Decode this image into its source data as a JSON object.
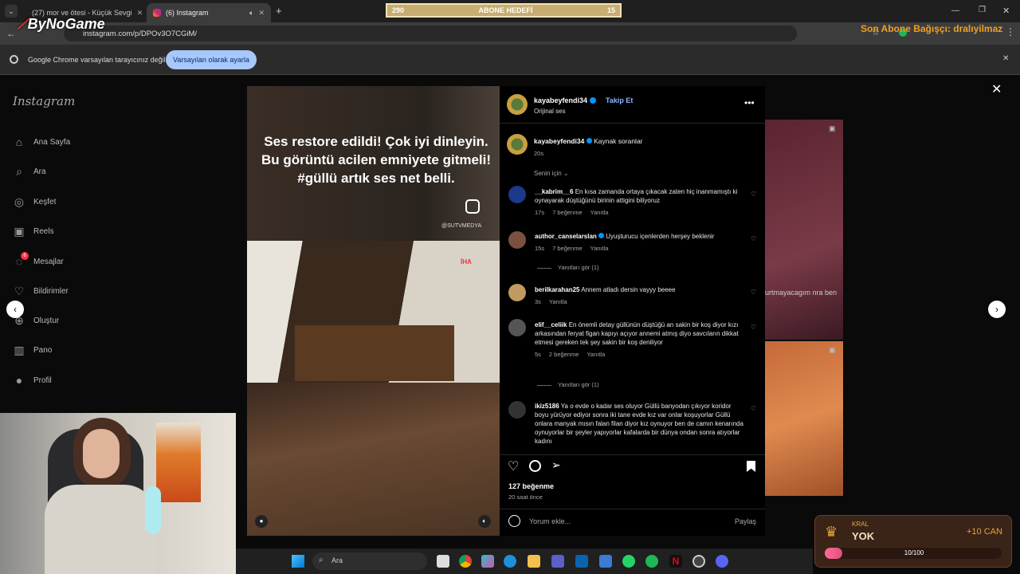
{
  "browser": {
    "tabs": [
      {
        "title": "(27) mor ve ötesi - Küçük Sevgi"
      },
      {
        "title": "(6) Instagram"
      }
    ],
    "url": "instagram.com/p/DPOv3O7CGiM/",
    "infobar_text": "Google Chrome varsayılan tarayıcınız değil",
    "infobar_button": "Varsayılan olarak ayarla"
  },
  "overlay": {
    "logo": "ByNoGame",
    "goal_left": "290",
    "goal_label": "ABONE HEDEFİ",
    "goal_right": "15",
    "donor_text": "Son Abone Bağışçı: dralıyilmaz",
    "king_label": "KRAL",
    "king_value": "YOK",
    "king_reward": "+10 CAN",
    "king_progress_text": "10/100",
    "king_progress": 0.1
  },
  "instagram": {
    "logo": "Instagram",
    "nav": [
      {
        "label": "Ana Sayfa",
        "icon": "home-icon"
      },
      {
        "label": "Ara",
        "icon": "search-icon"
      },
      {
        "label": "Keşfet",
        "icon": "compass-icon"
      },
      {
        "label": "Reels",
        "icon": "reels-icon"
      },
      {
        "label": "Mesajlar",
        "icon": "messenger-icon",
        "badge": "6"
      },
      {
        "label": "Bildirimler",
        "icon": "heart-icon"
      },
      {
        "label": "Oluştur",
        "icon": "plus-icon"
      },
      {
        "label": "Pano",
        "icon": "dashboard-icon"
      },
      {
        "label": "Profil",
        "icon": "profile-icon"
      }
    ],
    "post": {
      "overlay_text": "Ses restore edildi! Çok iyi dinleyin. Bu görüntü acilen emniyete gitmeli! #güllü artık ses net belli.",
      "watermark": "@SUTVMEDYA",
      "agency": "İHA"
    },
    "header": {
      "username": "kayabeyfendi34",
      "follow": "Takip Et",
      "audio": "Orijinal ses"
    },
    "caption": {
      "username": "kayabeyfendi34",
      "text": "Kaynak soranlar",
      "time": "20s"
    },
    "sort_label": "Senin için",
    "comments": [
      {
        "user": "__kabrim__6",
        "text": "En kısa zamanda ortaya çıkacak zaten hiç inanmamıştı ki oynayarak düştüğünü birinin attigini biliyoruz",
        "time": "17s",
        "likes": "7 beğenme",
        "reply": "Yanıtla"
      },
      {
        "user": "author_canselarslan",
        "text": "Uyuşturucu içenlerden herşey beklenir",
        "time": "15s",
        "likes": "7 beğenme",
        "reply": "Yanıtla",
        "view_replies": "Yanıtları gör (1)"
      },
      {
        "user": "berilkarahan25",
        "text": "Annem atladı dersin vayyy beeee",
        "time": "3s",
        "likes": "",
        "reply": "Yanıtla"
      },
      {
        "user": "elif__celiik",
        "text": "En önemli detay güllünün düştüğü an sakin bir koş diyor kızı arkasından feryat figan kapıyı açıyor annemi atmış diyo savcıların dikkat etmesi gereken tek şey sakin bir koş deniliyor",
        "time": "5s",
        "likes": "2 beğenme",
        "reply": "Yanıtla",
        "view_replies": "Yanıtları gör (1)"
      },
      {
        "user": "ikiz5186",
        "text": "Ya o evde o kadar ses oluyor Güllü banyodan çıkıyor koridor boyu yürüyor ediyor sonra iki tane evde kız var onlar koşuyorlar Güllü onlara manyak mısın falan filan diyor kız oynuyor ben de camın kenarında oynuyorlar bir şeyler yapıyorlar kafalarda bir dünya ondan sonra atıyorlar kadını",
        "time": "",
        "likes": "",
        "reply": ""
      }
    ],
    "likes": "127 beğenme",
    "posted": "20 saat önce",
    "comment_placeholder": "Yorum ekle...",
    "post_button": "Paylaş",
    "background_text": "urtmayacagım nra ben"
  },
  "taskbar": {
    "search_label": "Ara"
  },
  "colors": {
    "instagram_blue": "#0095f6",
    "link_blue": "#8db4ff",
    "gold": "#e6a23c",
    "goal_bg": "#c7ad70",
    "chrome_tab": "#3c3c3c"
  }
}
